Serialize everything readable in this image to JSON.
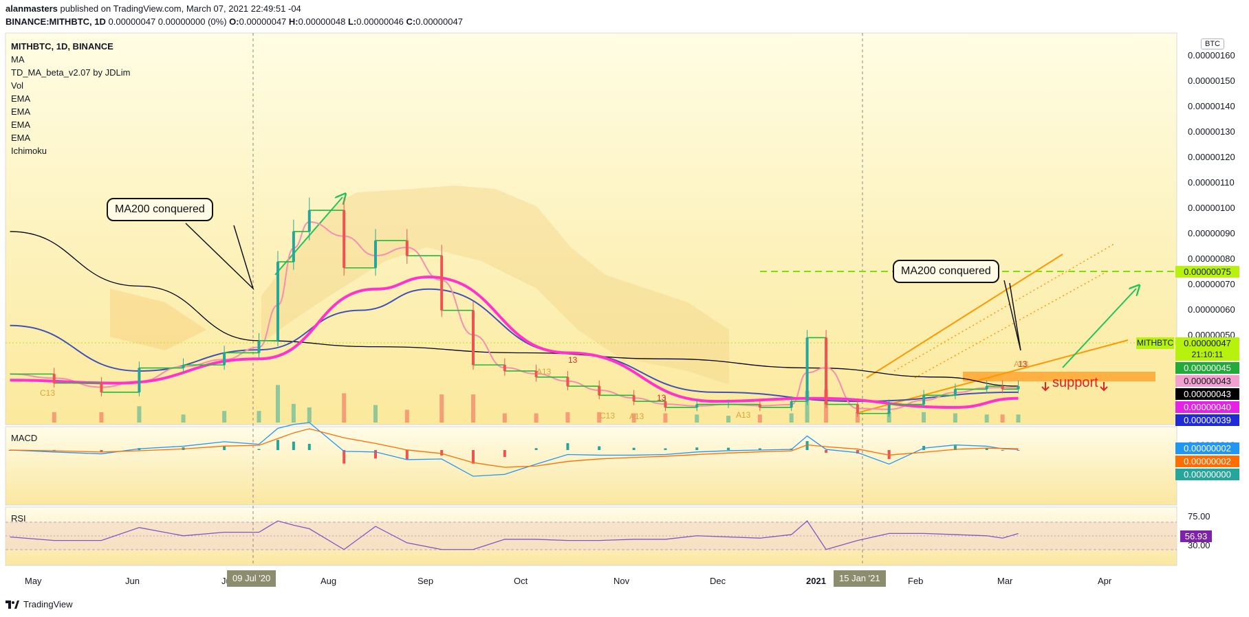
{
  "header": {
    "line1_user": "alanmasters",
    "line1_rest": " published on TradingView.com, March 07, 2021 22:49:51 -04",
    "line2_symbol": "BINANCE:MITHBTC, 1D",
    "line2_values": " 0.00000047 0.00000000 (0%) ",
    "o_label": "O:",
    "o_value": "0.00000047",
    "h_label": " H:",
    "h_value": "0.00000048",
    "l_label": " L:",
    "l_value": "0.00000046",
    "c_label": " C:",
    "c_value": "0.00000047"
  },
  "legend": {
    "title": "MITHBTC, 1D, BINANCE",
    "items": [
      "MA",
      "TD_MA_beta_v2.07 by JDLim",
      "Vol",
      "EMA",
      "EMA",
      "EMA",
      "EMA",
      "Ichimoku"
    ]
  },
  "currency_badge": "BTC",
  "price_axis": [
    "0.00000160",
    "0.00000150",
    "0.00000140",
    "0.00000130",
    "0.00000120",
    "0.00000110",
    "0.00000100",
    "0.00000090",
    "0.00000080",
    "0.00000070",
    "0.00000060",
    "0.00000050"
  ],
  "price_tags": [
    {
      "text": "0.00000075",
      "bg": "#b7f20f",
      "fg": "#131722"
    },
    {
      "text": "0.00000045",
      "bg": "#22ab38",
      "fg": "#ffffff"
    },
    {
      "text": "0.00000043",
      "bg": "#f2a0d0",
      "fg": "#131722"
    },
    {
      "text": "0.00000043",
      "bg": "#000000",
      "fg": "#ffffff"
    },
    {
      "text": "0.00000040",
      "bg": "#e522e5",
      "fg": "#ffffff"
    },
    {
      "text": "0.00000039",
      "bg": "#1e2bd6",
      "fg": "#ffffff"
    }
  ],
  "last_price_tag": {
    "symbol": "MITHBTC",
    "value": "0.00000047",
    "countdown": "21:10:11"
  },
  "macd": {
    "label": "MACD",
    "tags": [
      {
        "text": "0.00000002",
        "bg": "#2196f3"
      },
      {
        "text": "0.00000002",
        "bg": "#ff6d00"
      },
      {
        "text": "0.00000000",
        "bg": "#26a69a"
      }
    ],
    "partial_axis": "0.00000010"
  },
  "rsi": {
    "label": "RSI",
    "upper": "75.00",
    "lower": "30.00",
    "value": "56.93"
  },
  "time_axis": {
    "months": [
      "May",
      "Jun",
      "Jul",
      "Aug",
      "Sep",
      "Oct",
      "Nov",
      "Dec",
      "2021",
      "Feb",
      "Mar",
      "Apr"
    ],
    "highlight_dates": [
      "09 Jul '20",
      "15 Jan '21"
    ]
  },
  "annotations": {
    "callout_left": "MA200 conquered",
    "callout_right": "MA200 conquered",
    "support": "support",
    "td_marks": [
      "C13",
      "A13",
      "13",
      "13",
      "A13",
      "C13",
      "A13",
      "A13",
      "13"
    ]
  },
  "colors": {
    "background_gradient_top": "#fffde4",
    "background_gradient_bottom": "#fbe99c",
    "candle_up": "#26a69a",
    "candle_down": "#ef5350",
    "ma200": "#000000",
    "ema_blue": "#3f51b5",
    "ema_magenta": "#ff33cc",
    "ema_pink": "#f48fb1",
    "td_green": "#22b83a",
    "trend_orange": "#ff9800",
    "resistance_green": "#7fe000",
    "arrow_green": "#22c35a",
    "support_zone": "#ffa630",
    "support_text": "#e02222"
  },
  "footer": {
    "brand": "TradingView"
  },
  "chart_data": {
    "type": "line",
    "title": "MITHBTC, 1D, BINANCE",
    "x_range": [
      "2020-04-20",
      "2021-04-25"
    ],
    "ylim": [
      3.5e-07,
      1.63e-06
    ],
    "price_series": {
      "name": "MITHBTC",
      "x": [
        "2020-04-21",
        "2020-05-05",
        "2020-05-20",
        "2020-06-01",
        "2020-06-15",
        "2020-06-28",
        "2020-07-09",
        "2020-07-15",
        "2020-07-20",
        "2020-07-25",
        "2020-08-05",
        "2020-08-15",
        "2020-08-25",
        "2020-09-05",
        "2020-09-15",
        "2020-09-25",
        "2020-10-05",
        "2020-10-15",
        "2020-10-25",
        "2020-11-05",
        "2020-11-15",
        "2020-11-25",
        "2020-12-05",
        "2020-12-15",
        "2020-12-25",
        "2020-12-30",
        "2021-01-05",
        "2021-01-15",
        "2021-01-25",
        "2021-02-05",
        "2021-02-15",
        "2021-02-25",
        "2021-03-02",
        "2021-03-07"
      ],
      "values": [
        5.1e-07,
        4.8e-07,
        4.5e-07,
        5.3e-07,
        5.4e-07,
        5.8e-07,
        6.2e-07,
        8.8e-07,
        9.8e-07,
        1.05e-06,
        8.6e-07,
        9.5e-07,
        9e-07,
        7.2e-07,
        5.4e-07,
        5.2e-07,
        5e-07,
        4.7e-07,
        4.4e-07,
        4.2e-07,
        4e-07,
        4.1e-07,
        4.1e-07,
        4e-07,
        4.2e-07,
        6.3e-07,
        4.1e-07,
        3.8e-07,
        4.1e-07,
        4.4e-07,
        4.6e-07,
        4.7e-07,
        4.6e-07,
        4.7e-07
      ]
    },
    "ma200": {
      "name": "MA",
      "x": [
        "2020-04-21",
        "2020-06-01",
        "2020-07-09",
        "2020-08-15",
        "2020-10-01",
        "2020-11-15",
        "2021-01-01",
        "2021-02-10",
        "2021-03-07"
      ],
      "values": [
        9.8e-07,
        8e-07,
        6.2e-07,
        6e-07,
        5.8e-07,
        5.6e-07,
        5.3e-07,
        5e-07,
        4.7e-07
      ]
    },
    "ema_blue": {
      "name": "EMA",
      "x": [
        "2020-04-21",
        "2020-06-01",
        "2020-07-09",
        "2020-08-10",
        "2020-09-01",
        "2020-10-15",
        "2020-12-01",
        "2021-01-15",
        "2021-03-07"
      ],
      "values": [
        6.7e-07,
        5.2e-07,
        5.9e-07,
        7.2e-07,
        7.9e-07,
        5.8e-07,
        4.5e-07,
        4.2e-07,
        4.5e-07
      ]
    },
    "ema_magenta": {
      "name": "EMA",
      "x": [
        "2020-04-21",
        "2020-05-25",
        "2020-07-09",
        "2020-08-15",
        "2020-09-01",
        "2020-10-15",
        "2020-12-01",
        "2021-01-01",
        "2021-02-15",
        "2021-03-07"
      ],
      "values": [
        4.9e-07,
        4.8e-07,
        5.6e-07,
        7.9e-07,
        8.3e-07,
        5.8e-07,
        4.2e-07,
        4.3e-07,
        4e-07,
        4.3e-07
      ]
    },
    "resistance_level": 7.5e-07,
    "support_zone": [
      3.65e-07,
      3.85e-07
    ],
    "rsi": {
      "levels": [
        30,
        75
      ],
      "last": 56.93
    }
  }
}
